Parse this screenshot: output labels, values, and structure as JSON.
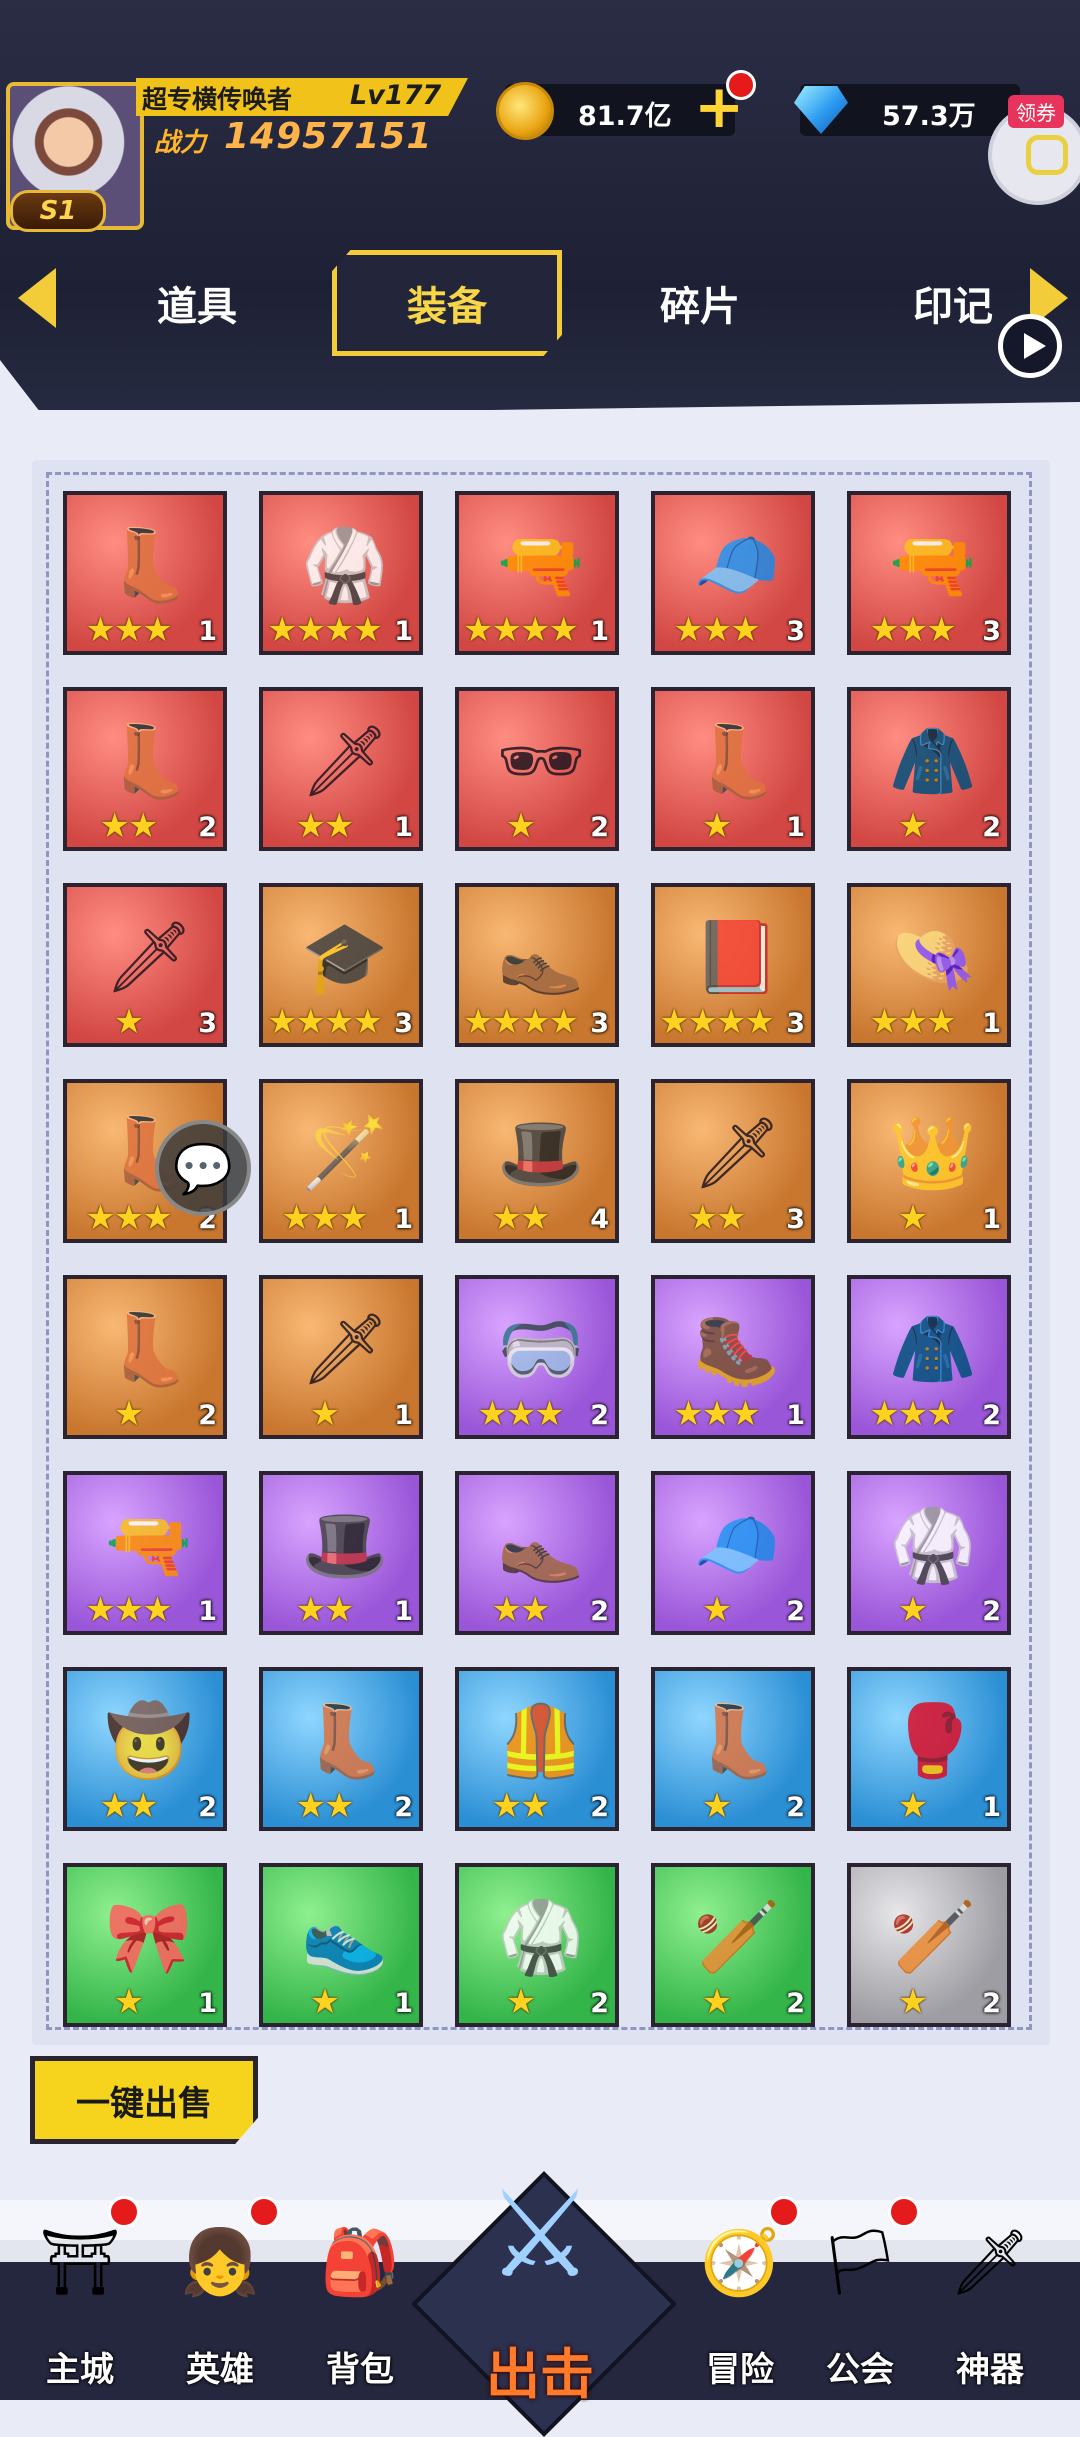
{
  "player": {
    "name": "超专横传唤者",
    "level": "Lv177",
    "power_label": "战力",
    "power": "14957151",
    "vip": "S1"
  },
  "currencies": [
    {
      "icon": "gold-coin-icon",
      "amount": "81.7亿"
    },
    {
      "icon": "diamond-icon",
      "amount": "57.3万"
    }
  ],
  "coupon": {
    "label": "领券"
  },
  "tabs": [
    {
      "label": "道具",
      "active": false
    },
    {
      "label": "装备",
      "active": true
    },
    {
      "label": "碎片",
      "active": false
    },
    {
      "label": "印记",
      "active": false
    }
  ],
  "items": [
    {
      "name": "boots",
      "icon": "👢",
      "rarity": "red",
      "stars": "★★★",
      "count": "1"
    },
    {
      "name": "armor",
      "icon": "🥋",
      "rarity": "red",
      "stars": "★★★★",
      "count": "1"
    },
    {
      "name": "blaster",
      "icon": "🔫",
      "rarity": "red",
      "stars": "★★★★",
      "count": "1"
    },
    {
      "name": "detective-hat",
      "icon": "🧢",
      "rarity": "red",
      "stars": "★★★",
      "count": "3"
    },
    {
      "name": "pistol",
      "icon": "🔫",
      "rarity": "red",
      "stars": "★★★",
      "count": "3"
    },
    {
      "name": "red-boots",
      "icon": "👢",
      "rarity": "red",
      "stars": "★★",
      "count": "2"
    },
    {
      "name": "red-sword",
      "icon": "🗡",
      "rarity": "red",
      "stars": "★★",
      "count": "1"
    },
    {
      "name": "eyepatch",
      "icon": "🕶",
      "rarity": "red",
      "stars": "★",
      "count": "2"
    },
    {
      "name": "dark-boots",
      "icon": "👢",
      "rarity": "red",
      "stars": "★",
      "count": "1"
    },
    {
      "name": "coat",
      "icon": "🧥",
      "rarity": "red",
      "stars": "★",
      "count": "2"
    },
    {
      "name": "buster-sword",
      "icon": "🗡",
      "rarity": "red",
      "stars": "★",
      "count": "3"
    },
    {
      "name": "graduation-cap",
      "icon": "🎓",
      "rarity": "orange",
      "stars": "★★★★",
      "count": "3"
    },
    {
      "name": "black-shoes",
      "icon": "👞",
      "rarity": "orange",
      "stars": "★★★★",
      "count": "3"
    },
    {
      "name": "magic-book",
      "icon": "📕",
      "rarity": "orange",
      "stars": "★★★★",
      "count": "3"
    },
    {
      "name": "purple-hat",
      "icon": "👒",
      "rarity": "orange",
      "stars": "★★★",
      "count": "1"
    },
    {
      "name": "leather-boots",
      "icon": "👢",
      "rarity": "orange",
      "stars": "★★★",
      "count": "2"
    },
    {
      "name": "scepter",
      "icon": "🪄",
      "rarity": "orange",
      "stars": "★★★",
      "count": "1"
    },
    {
      "name": "feather-hat",
      "icon": "🎩",
      "rarity": "orange",
      "stars": "★★",
      "count": "4"
    },
    {
      "name": "long-sword",
      "icon": "🗡",
      "rarity": "orange",
      "stars": "★★",
      "count": "3"
    },
    {
      "name": "feather-crown",
      "icon": "👑",
      "rarity": "orange",
      "stars": "★",
      "count": "1"
    },
    {
      "name": "steel-boots",
      "icon": "👢",
      "rarity": "orange",
      "stars": "★",
      "count": "2"
    },
    {
      "name": "rapier",
      "icon": "🗡",
      "rarity": "orange",
      "stars": "★",
      "count": "1"
    },
    {
      "name": "goggles",
      "icon": "🥽",
      "rarity": "purple",
      "stars": "★★★",
      "count": "2"
    },
    {
      "name": "work-boots",
      "icon": "🥾",
      "rarity": "purple",
      "stars": "★★★",
      "count": "1"
    },
    {
      "name": "jacket",
      "icon": "🧥",
      "rarity": "purple",
      "stars": "★★★",
      "count": "2"
    },
    {
      "name": "revolver",
      "icon": "🔫",
      "rarity": "purple",
      "stars": "★★★",
      "count": "1"
    },
    {
      "name": "official-hat",
      "icon": "🎩",
      "rarity": "purple",
      "stars": "★★",
      "count": "1"
    },
    {
      "name": "black-boots",
      "icon": "👞",
      "rarity": "purple",
      "stars": "★★",
      "count": "2"
    },
    {
      "name": "camo-cap",
      "icon": "🧢",
      "rarity": "purple",
      "stars": "★",
      "count": "2"
    },
    {
      "name": "military-uniform",
      "icon": "🥋",
      "rarity": "purple",
      "stars": "★",
      "count": "2"
    },
    {
      "name": "cowboy-hat",
      "icon": "🤠",
      "rarity": "blue",
      "stars": "★★",
      "count": "2"
    },
    {
      "name": "brown-boots",
      "icon": "👢",
      "rarity": "blue",
      "stars": "★★",
      "count": "2"
    },
    {
      "name": "sheriff-vest",
      "icon": "🦺",
      "rarity": "blue",
      "stars": "★★",
      "count": "2"
    },
    {
      "name": "white-boots",
      "icon": "👢",
      "rarity": "blue",
      "stars": "★",
      "count": "2"
    },
    {
      "name": "boxing-glove",
      "icon": "🥊",
      "rarity": "blue",
      "stars": "★",
      "count": "1"
    },
    {
      "name": "headband",
      "icon": "🎀",
      "rarity": "green",
      "stars": "★",
      "count": "1"
    },
    {
      "name": "sneakers",
      "icon": "👟",
      "rarity": "green",
      "stars": "★",
      "count": "1"
    },
    {
      "name": "karate-gi",
      "icon": "🥋",
      "rarity": "green",
      "stars": "★",
      "count": "2"
    },
    {
      "name": "wooden-club",
      "icon": "🏏",
      "rarity": "green",
      "stars": "★",
      "count": "2"
    },
    {
      "name": "baseball-bat",
      "icon": "🏏",
      "rarity": "gray",
      "stars": "★",
      "count": "2"
    }
  ],
  "sell_button": "一键出售",
  "nav": [
    {
      "label": "主城",
      "icon": "⛩",
      "dot": true
    },
    {
      "label": "英雄",
      "icon": "👧",
      "dot": true
    },
    {
      "label": "背包",
      "icon": "🎒",
      "dot": false
    },
    {
      "label": "出击",
      "icon": "⚔",
      "main": true
    },
    {
      "label": "冒险",
      "icon": "🧭",
      "dot": true
    },
    {
      "label": "公会",
      "icon": "🏳",
      "dot": true
    },
    {
      "label": "神器",
      "icon": "🗡",
      "dot": false
    }
  ]
}
